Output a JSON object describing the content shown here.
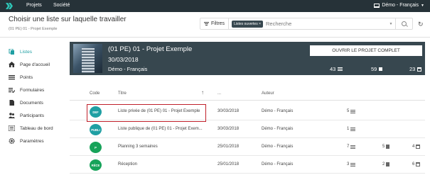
{
  "topnav": {
    "items": [
      "Projets",
      "Société"
    ],
    "user": "Démo - Français"
  },
  "header": {
    "title": "Choisir une liste sur laquelle travailler",
    "breadcrumb": "(01 PE) 01 - Projet Exemple",
    "filters_label": "Filtres",
    "active_filter": "Listes ouvertes ×",
    "search_placeholder": "Recherche"
  },
  "sidebar": {
    "items": [
      {
        "label": "Listes",
        "icon": "layers-icon",
        "active": true
      },
      {
        "label": "Page d'accueil",
        "icon": "home-icon",
        "active": false
      },
      {
        "label": "Points",
        "icon": "list-icon",
        "active": false
      },
      {
        "label": "Formulaires",
        "icon": "checklist-icon",
        "active": false
      },
      {
        "label": "Documents",
        "icon": "document-icon",
        "active": false
      },
      {
        "label": "Participants",
        "icon": "people-icon",
        "active": false
      },
      {
        "label": "Tableau de bord",
        "icon": "dashboard-icon",
        "active": false
      },
      {
        "label": "Paramètres",
        "icon": "gear-icon",
        "active": false
      }
    ]
  },
  "project": {
    "name": "(01 PE) 01 - Projet Exemple",
    "date": "30/03/2018",
    "user": "Démo - Français",
    "open_button": "OUVRIR LE PROJET COMPLET",
    "counts": [
      "43",
      "59",
      "23"
    ]
  },
  "table": {
    "headers": {
      "code": "Code",
      "title": "Titre",
      "dots": "...",
      "author": "Auteur"
    },
    "rows": [
      {
        "code": "DEF",
        "color": "#1f9fa3",
        "title": "Liste privée de (01 PE) 01 - Projet Exemple",
        "date": "30/03/2018",
        "author": "Démo - Français",
        "points": "5",
        "docs": "",
        "cal": ""
      },
      {
        "code": "PUBLI",
        "color": "#1f9fa3",
        "title": "Liste publique de (01 PE) 01 - Projet Exem...",
        "date": "30/03/2018",
        "author": "Démo - Français",
        "points": "1",
        "docs": "",
        "cal": ""
      },
      {
        "code": "P",
        "color": "#17a35a",
        "title": "Planning 3 semaines",
        "date": "25/01/2018",
        "author": "Démo - Français",
        "points": "7",
        "docs": "5",
        "cal": "4"
      },
      {
        "code": "RÉCE",
        "color": "#17a35a",
        "title": "Réception",
        "date": "25/01/2018",
        "author": "Démo - Français",
        "points": "3",
        "docs": "2",
        "cal": "6"
      }
    ]
  },
  "colors": {
    "accent": "#1f9fa3",
    "nav_bg": "#263238",
    "banner_bg": "#37474f",
    "highlight": "#c0202a"
  }
}
